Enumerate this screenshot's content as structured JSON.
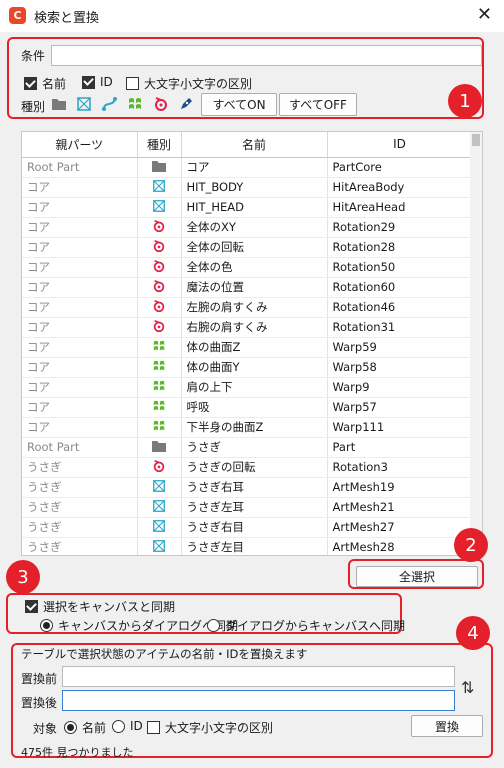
{
  "window": {
    "title": "検索と置換",
    "close_glyph": "✕"
  },
  "badges": [
    "1",
    "2",
    "3",
    "4"
  ],
  "filter": {
    "condition_label": "条件",
    "condition_value": "",
    "name_label": "名前",
    "id_label": "ID",
    "case_label": "大文字小文字の区別",
    "kind_label": "種別",
    "all_on": "すべてON",
    "all_off": "すべてOFF"
  },
  "table": {
    "headers": [
      "親パーツ",
      "種別",
      "名前",
      "ID"
    ],
    "rows": [
      {
        "parent": "Root Part",
        "kind": "folder",
        "name": "コア",
        "id": "PartCore"
      },
      {
        "parent": "コア",
        "kind": "mesh",
        "name": "HIT_BODY",
        "id": "HitAreaBody"
      },
      {
        "parent": "コア",
        "kind": "mesh",
        "name": "HIT_HEAD",
        "id": "HitAreaHead"
      },
      {
        "parent": "コア",
        "kind": "rotation",
        "name": "全体のXY",
        "id": "Rotation29"
      },
      {
        "parent": "コア",
        "kind": "rotation",
        "name": "全体の回転",
        "id": "Rotation28"
      },
      {
        "parent": "コア",
        "kind": "rotation",
        "name": "全体の色",
        "id": "Rotation50"
      },
      {
        "parent": "コア",
        "kind": "rotation",
        "name": "魔法の位置",
        "id": "Rotation60"
      },
      {
        "parent": "コア",
        "kind": "rotation",
        "name": "左腕の肩すくみ",
        "id": "Rotation46"
      },
      {
        "parent": "コア",
        "kind": "rotation",
        "name": "右腕の肩すくみ",
        "id": "Rotation31"
      },
      {
        "parent": "コア",
        "kind": "warp",
        "name": "体の曲面Z",
        "id": "Warp59"
      },
      {
        "parent": "コア",
        "kind": "warp",
        "name": "体の曲面Y",
        "id": "Warp58"
      },
      {
        "parent": "コア",
        "kind": "warp",
        "name": "肩の上下",
        "id": "Warp9"
      },
      {
        "parent": "コア",
        "kind": "warp",
        "name": "呼吸",
        "id": "Warp57"
      },
      {
        "parent": "コア",
        "kind": "warp",
        "name": "下半身の曲面Z",
        "id": "Warp111"
      },
      {
        "parent": "Root Part",
        "kind": "folder",
        "name": "うさぎ",
        "id": "Part"
      },
      {
        "parent": "うさぎ",
        "kind": "rotation",
        "name": "うさぎの回転",
        "id": "Rotation3"
      },
      {
        "parent": "うさぎ",
        "kind": "mesh",
        "name": "うさぎ右耳",
        "id": "ArtMesh19"
      },
      {
        "parent": "うさぎ",
        "kind": "mesh",
        "name": "うさぎ左耳",
        "id": "ArtMesh21"
      },
      {
        "parent": "うさぎ",
        "kind": "mesh",
        "name": "うさぎ右目",
        "id": "ArtMesh27"
      },
      {
        "parent": "うさぎ",
        "kind": "mesh",
        "name": "うさぎ左目",
        "id": "ArtMesh28"
      }
    ]
  },
  "select_all": "全選択",
  "sync": {
    "sync_label": "選択をキャンバスと同期",
    "canvas_to_dialog": "キャンバスからダイアログへ同期",
    "dialog_to_canvas": "ダイアログからキャンバスへ同期"
  },
  "replace": {
    "description": "テーブルで選択状態のアイテムの名前・IDを置換えます",
    "before_label": "置換前",
    "after_label": "置換後",
    "before_value": "",
    "after_value": "",
    "swap_glyph": "⇅",
    "target_label": "対象",
    "name_label": "名前",
    "id_label": "ID",
    "case_label": "大文字小文字の区別",
    "replace_button": "置換"
  },
  "status": "475件 見つかりました",
  "colors": {
    "highlight": "#e4212a",
    "folder": "#7a7a7a",
    "mesh": "#2aa6c9",
    "rotation": "#e0224b",
    "warp": "#5cb82e",
    "glue": "#2aa6c9",
    "pen": "#1f4d8a"
  }
}
